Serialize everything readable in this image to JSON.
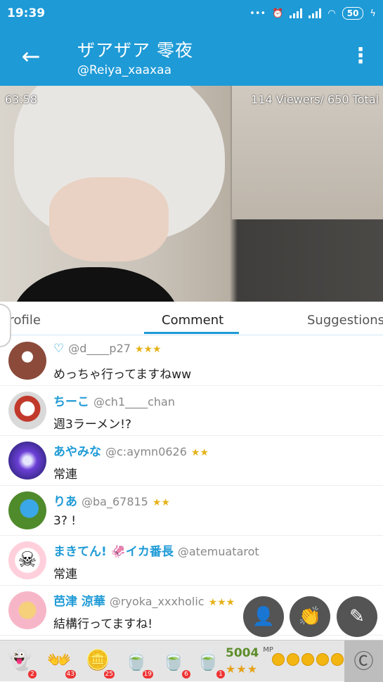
{
  "status": {
    "time": "19:39",
    "battery": "50"
  },
  "header": {
    "title": "ザアザア 零夜",
    "handle": "@Reiya_xaaxaa"
  },
  "video": {
    "timer": "63:58",
    "viewers": "114 Viewers/ 650 Total"
  },
  "tabs": [
    "Profile",
    "Comment",
    "Suggestions"
  ],
  "comments": [
    {
      "name": "♡",
      "id": "@d____p27",
      "stars": "★★★",
      "text": "めっちゃ行ってますねww"
    },
    {
      "name": "ちーこ",
      "id": "@ch1____chan",
      "stars": "",
      "text": "週3ラーメン!?"
    },
    {
      "name": "あやみな",
      "id": "@c:aymn0626",
      "stars": "★★",
      "text": "常連"
    },
    {
      "name": "りあ",
      "id": "@ba_67815",
      "stars": "★★",
      "text": "3? !"
    },
    {
      "name": "まきてん! 🦑イカ番長",
      "id": "@atemuatarot",
      "stars": "",
      "text": "常連"
    },
    {
      "name": "芭津 涼華",
      "id": "@ryoka_xxxholic",
      "stars": "★★★",
      "text": "結構行ってますね!"
    }
  ],
  "footer": {
    "gifts": [
      {
        "icon": "ghost-icon",
        "count": "2"
      },
      {
        "icon": "hands-icon",
        "count": "43"
      },
      {
        "icon": "coin-stack-icon",
        "count": "25"
      },
      {
        "icon": "tea-can-100-icon",
        "count": "19"
      },
      {
        "icon": "tea-can-icon",
        "count": "6"
      },
      {
        "icon": "tea-can-50-icon",
        "count": "1"
      }
    ],
    "mp": "5004",
    "mp_unit": "MP",
    "mp_stars": "★★★"
  }
}
